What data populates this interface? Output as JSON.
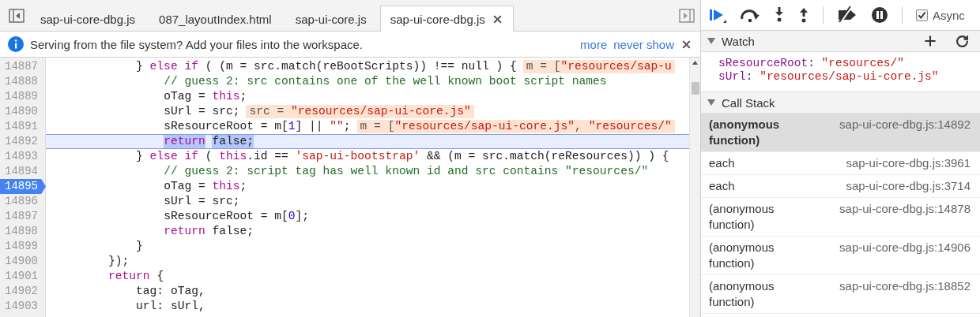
{
  "editor": {
    "tabs": [
      {
        "label": "sap-ui-core-dbg.js",
        "selected": false
      },
      {
        "label": "087_layoutIndex.html",
        "selected": false
      },
      {
        "label": "sap-ui-core.js",
        "selected": false
      },
      {
        "label": "sap-ui-core-dbg.js",
        "selected": true
      }
    ]
  },
  "infobar": {
    "message": "Serving from the file system? Add your files into the workspace.",
    "links": [
      "more",
      "never show"
    ]
  },
  "code": {
    "lines": [
      {
        "number": "14887",
        "current": false,
        "breakpoint": false,
        "tokens": [
          {
            "text": "            } ",
            "kind": "plain"
          },
          {
            "text": "else if",
            "kind": "keyword"
          },
          {
            "text": " ( (m = src.match(reBootScripts)) !== null ) {",
            "kind": "plain"
          }
        ],
        "value": [
          {
            "text": "m = [",
            "kind": "plain"
          },
          {
            "text": "\"resources/sap-u",
            "kind": "string"
          }
        ]
      },
      {
        "number": "14888",
        "current": false,
        "breakpoint": false,
        "tokens": [
          {
            "text": "                // guess 2: src contains one of the well known boot script names",
            "kind": "comment"
          }
        ]
      },
      {
        "number": "14889",
        "current": false,
        "breakpoint": false,
        "tokens": [
          {
            "text": "                oTag = ",
            "kind": "plain"
          },
          {
            "text": "this",
            "kind": "keyword"
          },
          {
            "text": ";",
            "kind": "plain"
          }
        ]
      },
      {
        "number": "14890",
        "current": false,
        "breakpoint": false,
        "tokens": [
          {
            "text": "                sUrl = src;",
            "kind": "plain"
          }
        ],
        "value": [
          {
            "text": "src = ",
            "kind": "plain"
          },
          {
            "text": "\"resources/sap-ui-core.js\"",
            "kind": "string"
          }
        ]
      },
      {
        "number": "14891",
        "current": false,
        "breakpoint": false,
        "tokens": [
          {
            "text": "                sResourceRoot = m[",
            "kind": "plain"
          },
          {
            "text": "1",
            "kind": "number"
          },
          {
            "text": "] || ",
            "kind": "plain"
          },
          {
            "text": "\"\"",
            "kind": "string"
          },
          {
            "text": ";",
            "kind": "plain"
          }
        ],
        "value": [
          {
            "text": "m = [",
            "kind": "plain"
          },
          {
            "text": "\"resources/sap-ui-core.js\"",
            "kind": "string"
          },
          {
            "text": ", ",
            "kind": "plain"
          },
          {
            "text": "\"resources/\"",
            "kind": "string"
          }
        ]
      },
      {
        "number": "14892",
        "current": true,
        "breakpoint": false,
        "tokens": [
          {
            "text": "                return",
            "kind": "keyword"
          },
          {
            "text": " false;",
            "kind": "plain"
          }
        ]
      },
      {
        "number": "14893",
        "current": false,
        "breakpoint": false,
        "tokens": [
          {
            "text": "            } ",
            "kind": "plain"
          },
          {
            "text": "else if",
            "kind": "keyword"
          },
          {
            "text": " ( ",
            "kind": "plain"
          },
          {
            "text": "this",
            "kind": "keyword"
          },
          {
            "text": ".id == ",
            "kind": "plain"
          },
          {
            "text": "'sap-ui-bootstrap'",
            "kind": "string"
          },
          {
            "text": " && (m = src.match(reResources)) ) {",
            "kind": "plain"
          }
        ]
      },
      {
        "number": "14894",
        "current": false,
        "breakpoint": false,
        "tokens": [
          {
            "text": "                // guess 2: script tag has well known id and src contains \"resources/\"",
            "kind": "comment"
          }
        ]
      },
      {
        "number": "14895",
        "current": false,
        "breakpoint": true,
        "tokens": [
          {
            "text": "                oTag = ",
            "kind": "plain"
          },
          {
            "text": "this",
            "kind": "keyword"
          },
          {
            "text": ";",
            "kind": "plain"
          }
        ]
      },
      {
        "number": "14896",
        "current": false,
        "breakpoint": false,
        "tokens": [
          {
            "text": "                sUrl = src;",
            "kind": "plain"
          }
        ]
      },
      {
        "number": "14897",
        "current": false,
        "breakpoint": false,
        "tokens": [
          {
            "text": "                sResourceRoot = m[",
            "kind": "plain"
          },
          {
            "text": "0",
            "kind": "number"
          },
          {
            "text": "];",
            "kind": "plain"
          }
        ]
      },
      {
        "number": "14898",
        "current": false,
        "breakpoint": false,
        "tokens": [
          {
            "text": "                return",
            "kind": "keyword"
          },
          {
            "text": " false;",
            "kind": "plain"
          }
        ]
      },
      {
        "number": "14899",
        "current": false,
        "breakpoint": false,
        "tokens": [
          {
            "text": "            }",
            "kind": "plain"
          }
        ]
      },
      {
        "number": "14900",
        "current": false,
        "breakpoint": false,
        "tokens": [
          {
            "text": "        });",
            "kind": "plain"
          }
        ]
      },
      {
        "number": "14901",
        "current": false,
        "breakpoint": false,
        "tokens": [
          {
            "text": "        return",
            "kind": "keyword"
          },
          {
            "text": " {",
            "kind": "plain"
          }
        ]
      },
      {
        "number": "14902",
        "current": false,
        "breakpoint": false,
        "tokens": [
          {
            "text": "            tag: oTag,",
            "kind": "plain"
          }
        ]
      },
      {
        "number": "14903",
        "current": false,
        "breakpoint": false,
        "tokens": [
          {
            "text": "            url: sUrl,",
            "kind": "plain"
          }
        ]
      }
    ]
  },
  "debugger": {
    "async": {
      "label": "Async",
      "checked": true
    },
    "watch": {
      "title": "Watch",
      "expanded": true,
      "items": [
        {
          "name": "sResourceRoot",
          "separator": ":",
          "value": "\"resources/\""
        },
        {
          "name": "sUrl",
          "separator": ":",
          "value": "\"resources/sap-ui-core.js\""
        }
      ]
    },
    "call_stack": {
      "title": "Call Stack",
      "expanded": true,
      "frames": [
        {
          "name": "(anonymous function)",
          "location": "sap-ui-core-dbg.js:14892",
          "selected": true
        },
        {
          "name": "each",
          "location": "sap-ui-core-dbg.js:3961",
          "selected": false
        },
        {
          "name": "each",
          "location": "sap-ui-core-dbg.js:3714",
          "selected": false
        },
        {
          "name": "(anonymous function)",
          "location": "sap-ui-core-dbg.js:14878",
          "selected": false
        },
        {
          "name": "(anonymous function)",
          "location": "sap-ui-core-dbg.js:14906",
          "selected": false
        },
        {
          "name": "(anonymous function)",
          "location": "sap-ui-core-dbg.js:18852",
          "selected": false
        }
      ]
    }
  }
}
